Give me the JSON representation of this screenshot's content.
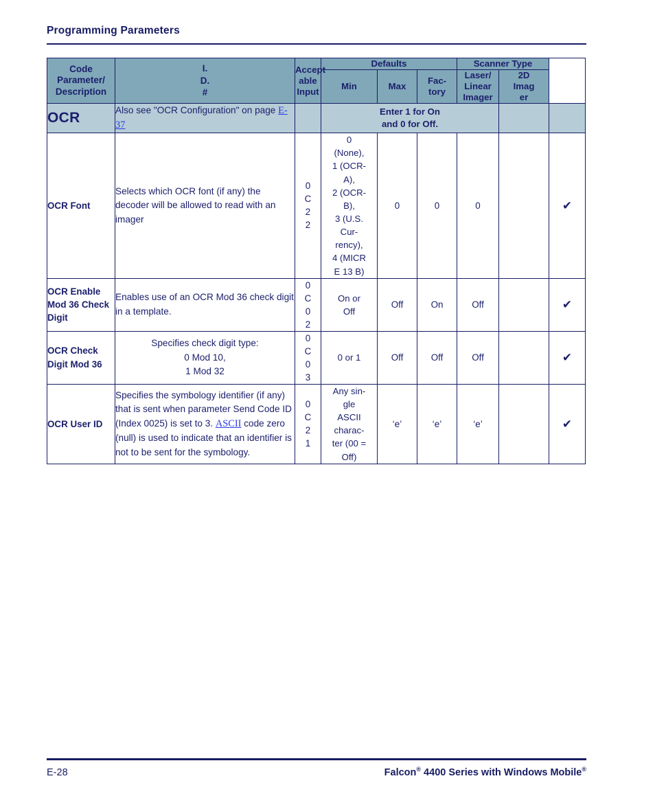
{
  "running_header": {
    "title": "Programming Parameters"
  },
  "table": {
    "headers": {
      "code_parameter": "Code Parameter/ Description",
      "id_number": "I.\nD.\n#",
      "id_number_lines": [
        "I.",
        "D.",
        "#"
      ],
      "acceptable_input": "Accept\nable\nInput",
      "acceptable_input_lines": [
        "Accept",
        "able",
        "Input"
      ],
      "defaults_group": "Defaults",
      "scanner_type_group": "Scanner Type",
      "min": "Min",
      "max": "Max",
      "factory_lines": [
        "Fac-",
        "tory"
      ],
      "laser_linear_imager_lines": [
        "Laser/",
        "Linear",
        "Imager"
      ],
      "two_d_imager_lines": [
        "2D",
        "Imag",
        "er"
      ]
    },
    "section": {
      "title": "OCR",
      "description_prefix": "Also see \"OCR Configuration\" on page ",
      "description_link": "E-37",
      "note_line1": "Enter 1 for On",
      "note_line2": "and 0 for Off."
    },
    "rows": [
      {
        "name": "OCR Font",
        "description": "Selects which OCR font (if any) the decoder will be allowed to read with an imager",
        "id_lines": [
          "0",
          "C",
          "2",
          "2"
        ],
        "acceptable_input_lines": [
          "0",
          "(None),",
          "1 (OCR-",
          "A),",
          "2 (OCR-",
          "B),",
          "3 (U.S.",
          "Cur-",
          "rency),",
          "4 (MICR",
          "E 13 B)"
        ],
        "min": "0",
        "max": "0",
        "factory": "0",
        "laser_linear_imager": "",
        "two_d_imager": "✔"
      },
      {
        "name": "OCR Enable Mod 36 Check Digit",
        "description": "Enables use of an OCR Mod 36 check digit in a template.",
        "id_lines": [
          "0",
          "C",
          "0",
          "2"
        ],
        "acceptable_input_lines": [
          "On or",
          "Off"
        ],
        "min": "Off",
        "max": "On",
        "factory": "Off",
        "laser_linear_imager": "",
        "two_d_imager": "✔"
      },
      {
        "name": "OCR Check Digit Mod 36",
        "description_lines": [
          "Specifies check digit type:",
          "0 Mod 10,",
          "1 Mod 32"
        ],
        "id_lines": [
          "0",
          "C",
          "0",
          "3"
        ],
        "acceptable_input_lines": [
          "0 or 1"
        ],
        "min": "Off",
        "max": "Off",
        "factory": "Off",
        "laser_linear_imager": "",
        "two_d_imager": "✔"
      },
      {
        "name": "OCR User ID",
        "description_part1": "Specifies the symbology identifier (if any) that is sent when parameter Send Code ID (Index 0025) is set to 3. ",
        "description_link": "ASCII",
        "description_part2": " code zero (null) is used to indicate that an identifier is not to be sent for the symbology.",
        "id_lines": [
          "0",
          "C",
          "2",
          "1"
        ],
        "acceptable_input_lines": [
          "Any sin-",
          "gle",
          "ASCII",
          "charac-",
          "ter (00 =",
          "Off)"
        ],
        "min": "‘e’",
        "max": "‘e’",
        "factory": "‘e’",
        "laser_linear_imager": "",
        "two_d_imager": "✔"
      }
    ]
  },
  "footer": {
    "page_number": "E-28",
    "doc_title_part1": "Falcon",
    "doc_title_sup1": "®",
    "doc_title_part2": " 4400 Series with Windows Mobile",
    "doc_title_sup2": "®"
  },
  "colors": {
    "header_bg": "#80a8b9",
    "section_bg": "#b6ccd7",
    "text": "#1b2170",
    "border": "#171c63",
    "link": "#2b3ce0"
  }
}
